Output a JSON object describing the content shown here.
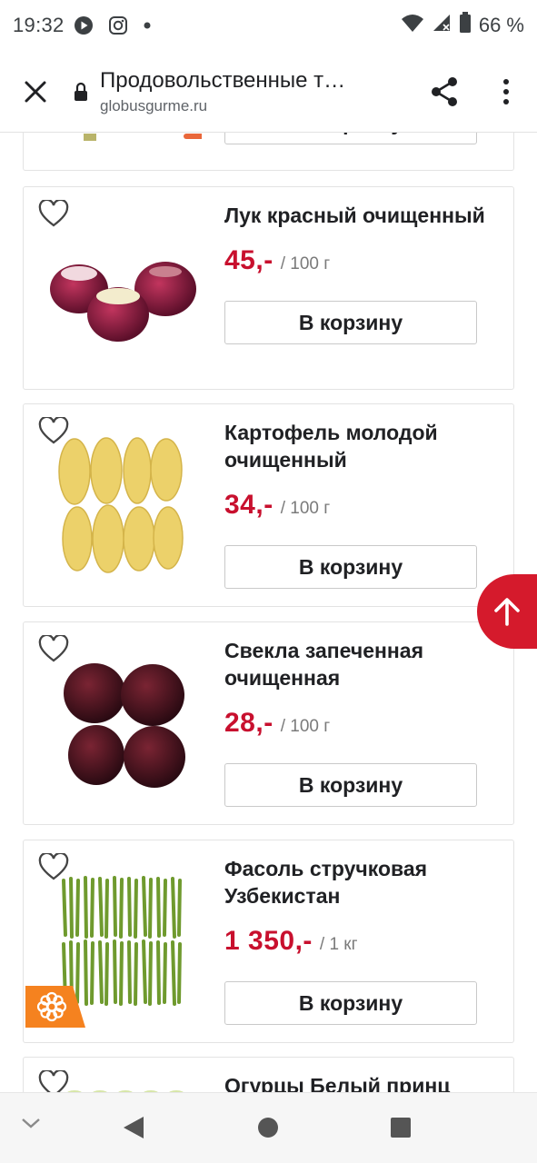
{
  "status_bar": {
    "time": "19:32",
    "battery": "66 %"
  },
  "browser": {
    "page_title": "Продовольственные т…",
    "domain": "globusgurme.ru"
  },
  "partial_top_card": {
    "button_label": "В корзину"
  },
  "products": [
    {
      "name": "Лук красный очищенный",
      "price": "45,-",
      "unit": "/ 100 г",
      "button_label": "В корзину",
      "image": "red-onion"
    },
    {
      "name": "Картофель молодой очищенный",
      "price": "34,-",
      "unit": "/ 100 г",
      "button_label": "В корзину",
      "image": "peeled-potato"
    },
    {
      "name": "Свекла запеченная очищенная",
      "price": "28,-",
      "unit": "/ 100 г",
      "button_label": "В корзину",
      "image": "baked-beet"
    },
    {
      "name": "Фасоль стручковая Узбекистан",
      "price": "1 350,-",
      "unit": "/ 1 кг",
      "button_label": "В корзину",
      "image": "green-beans",
      "badge": "flower-icon"
    }
  ],
  "partial_bottom_card": {
    "name": "Огурцы Белый принц"
  },
  "colors": {
    "price": "#c8102e",
    "scroll_top": "#d51a2c",
    "badge": "#f5821f"
  }
}
